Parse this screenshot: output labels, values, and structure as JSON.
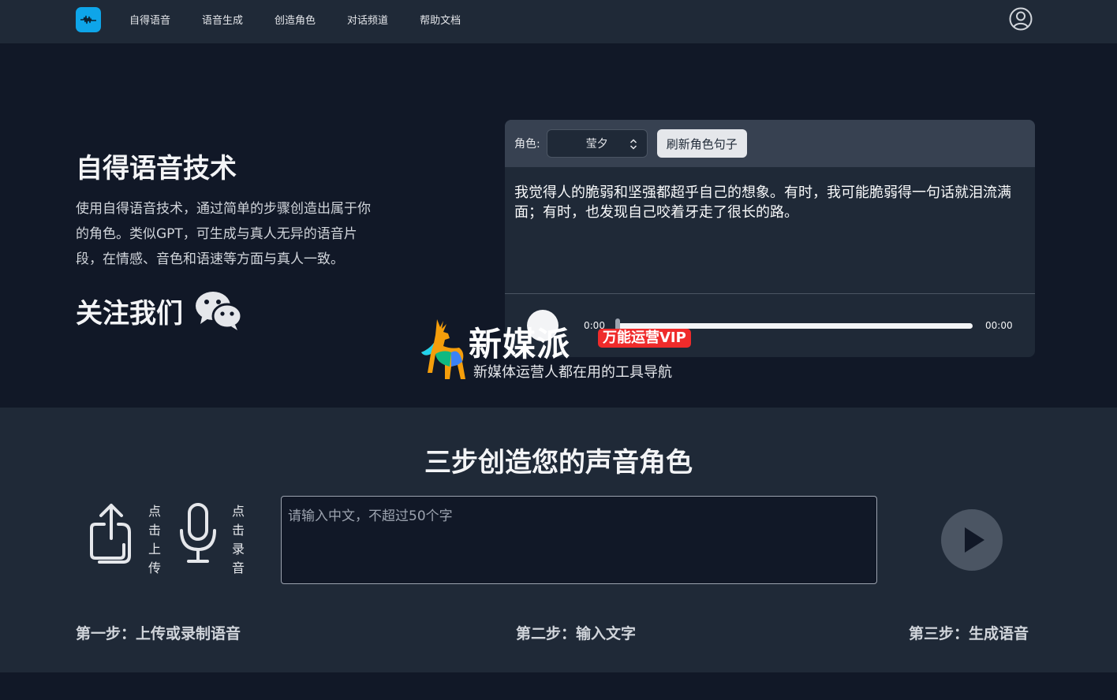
{
  "nav": {
    "items": [
      {
        "label": "自得语音"
      },
      {
        "label": "语音生成"
      },
      {
        "label": "创造角色"
      },
      {
        "label": "对话频道"
      },
      {
        "label": "帮助文档"
      }
    ]
  },
  "hero": {
    "title": "自得语音技术",
    "description": "使用自得语音技术，通过简单的步骤创造出属于你的角色。类似GPT，可生成与真人无异的语音片段，在情感、音色和语速等方面与真人一致。",
    "follow_title": "关注我们"
  },
  "demo_card": {
    "role_label": "角色:",
    "role_value": "莹夕",
    "refresh_label": "刷新角色句子",
    "sentence": "我觉得人的脆弱和坚强都超乎自己的想象。有时，我可能脆弱得一句话就泪流满面；有时，也发现自己咬着牙走了很长的路。",
    "time_start": "0:00",
    "time_end": "00:00"
  },
  "watermark": {
    "brand": "新媒派",
    "badge": "万能运营VIP",
    "slogan": "新媒体运营人都在用的工具导航"
  },
  "steps": {
    "title": "三步创造您的声音角色",
    "upload_label": "点击上传",
    "record_label": "点击录音",
    "input_placeholder": "请输入中文，不超过50个字",
    "step1": "第一步：上传或录制语音",
    "step2": "第二步：输入文字",
    "step3": "第三步：生成语音"
  },
  "colors": {
    "page_bg": "#111827",
    "panel_bg": "#1f2937",
    "logo": "#0ea5e9",
    "badge": "#ef2b2b"
  },
  "icons": [
    "waveform-logo-icon",
    "user-circle-icon",
    "wechat-icon",
    "chevron-updown-icon",
    "play-icon",
    "upload-icon",
    "microphone-icon"
  ]
}
